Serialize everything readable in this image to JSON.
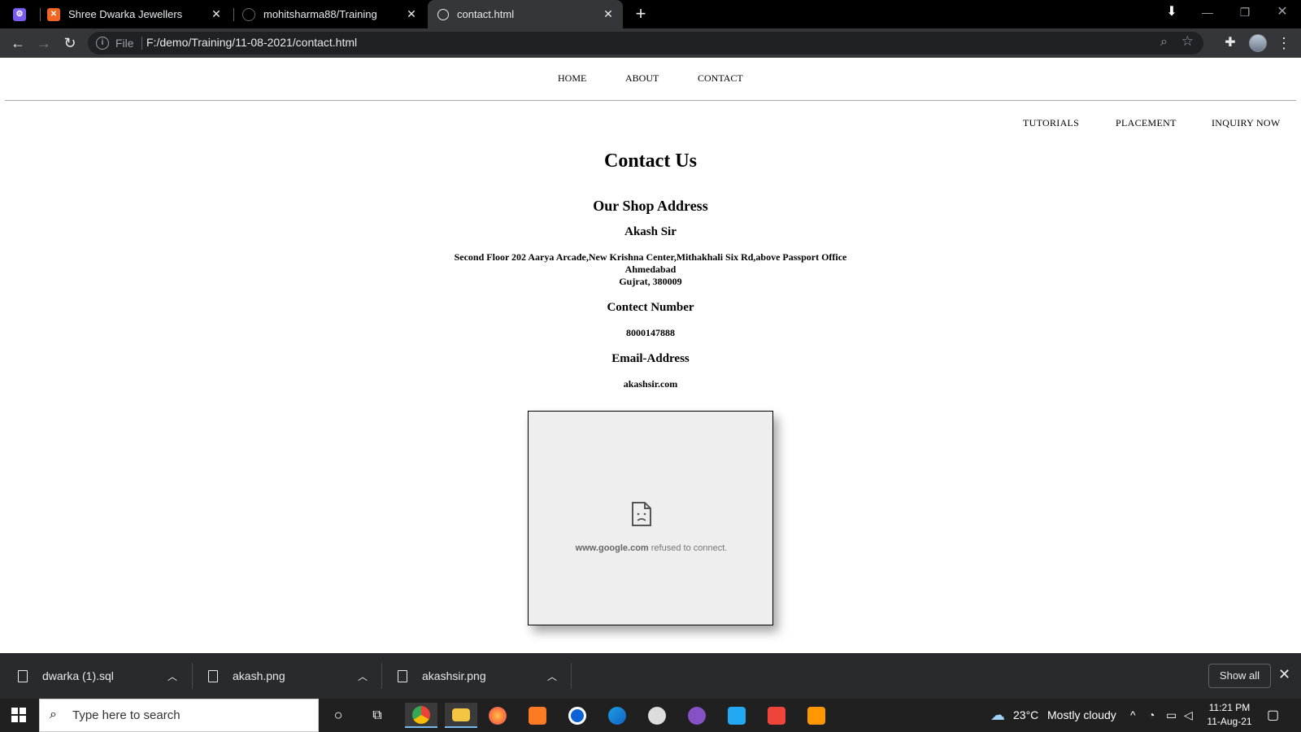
{
  "browser": {
    "tabs": [
      {
        "title": "",
        "icon": "extension-icon"
      },
      {
        "title": "Shree Dwarka Jewellers",
        "icon": "xampp-icon"
      },
      {
        "title": "mohitsharma88/Training",
        "icon": "github-icon"
      },
      {
        "title": "contact.html",
        "icon": "globe-icon",
        "active": true
      }
    ],
    "address": {
      "scheme": "File",
      "url": "F:/demo/Training/11-08-2021/contact.html"
    }
  },
  "page": {
    "topnav": [
      "HOME",
      "ABOUT",
      "CONTACT"
    ],
    "subnav": [
      "TUTORIALS",
      "PLACEMENT",
      "INQUIRY NOW"
    ],
    "title": "Contact Us",
    "shop_heading": "Our Shop Address",
    "owner": "Akash Sir",
    "address_line1": "Second Floor 202 Aarya Arcade,New Krishna Center,Mithakhali Six Rd,above Passport Office",
    "address_line2": "Ahmedabad",
    "address_line3": "Gujrat, 380009",
    "contact_heading": "Contect Number",
    "phone": "8000147888",
    "email_heading": "Email-Address",
    "email": "akashsir.com",
    "iframe": {
      "host": "www.google.com",
      "message": "refused to connect."
    }
  },
  "downloads": {
    "items": [
      {
        "name": "dwarka (1).sql"
      },
      {
        "name": "akash.png"
      },
      {
        "name": "akashsir.png"
      }
    ],
    "show_all": "Show all"
  },
  "taskbar": {
    "search_placeholder": "Type here to search",
    "apps": [
      "chrome-icon",
      "file-explorer-icon",
      "firefox-icon",
      "xampp-icon",
      "clock-app-icon",
      "edge-icon",
      "paint-icon",
      "github-desktop-icon",
      "vscode-icon",
      "anydesk-icon",
      "sublime-icon"
    ],
    "weather": {
      "temp": "23°C",
      "desc": "Mostly cloudy"
    },
    "time": "11:21 PM",
    "date": "11-Aug-21"
  },
  "colors": {
    "tabbar": "#000000",
    "toolbar": "#35363a",
    "downloads_bar": "#292a2d",
    "taskbar": "#202020"
  }
}
